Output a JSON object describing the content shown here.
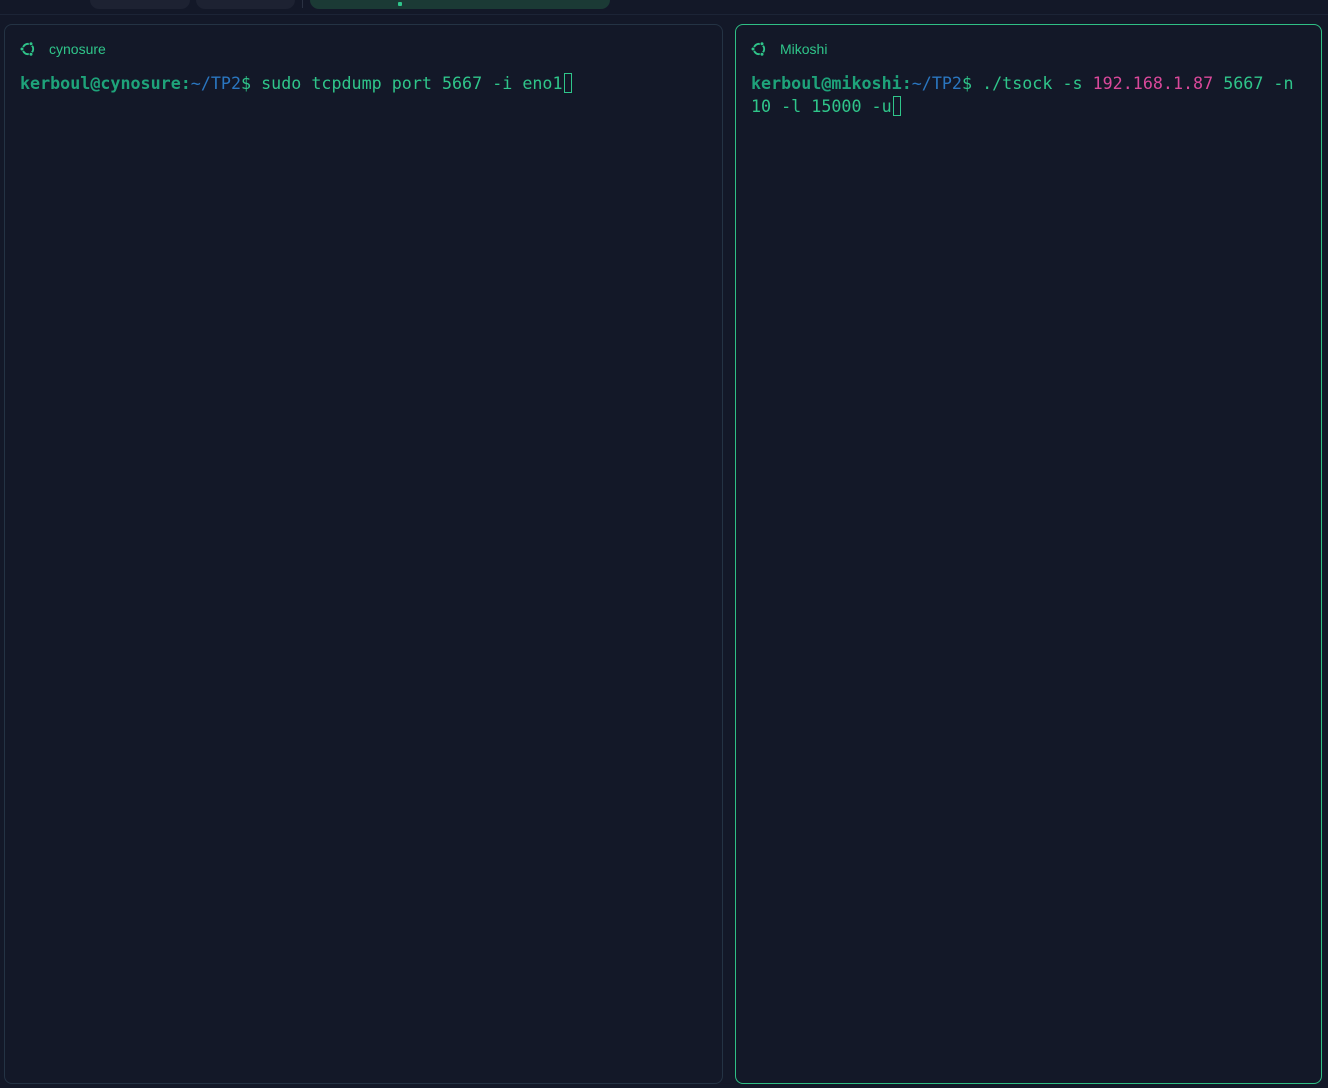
{
  "colors": {
    "background": "#131828",
    "accent": "#2fc58a",
    "path": "#2a76c0",
    "ip_highlight": "#d9489a",
    "active_border": "#2fbf85",
    "inactive_border": "#243344"
  },
  "panes": [
    {
      "title": "cynosure",
      "icon": "ubuntu-icon",
      "prompt": {
        "user_host": "kerboul@cynosure",
        "sep": ":",
        "path": "~/TP2",
        "symbol": "$"
      },
      "command": {
        "before_ip": " sudo tcpdump port 5667 -i eno1",
        "ip": "",
        "after_ip": ""
      }
    },
    {
      "title": "Mikoshi",
      "icon": "ubuntu-icon",
      "prompt": {
        "user_host": "kerboul@mikoshi",
        "sep": ":",
        "path": "~/TP2",
        "symbol": "$"
      },
      "command": {
        "before_ip": " ./tsock -s ",
        "ip": "192.168.1.87",
        "after_ip": " 5667 -n 10 -l 15000 -u"
      }
    }
  ]
}
